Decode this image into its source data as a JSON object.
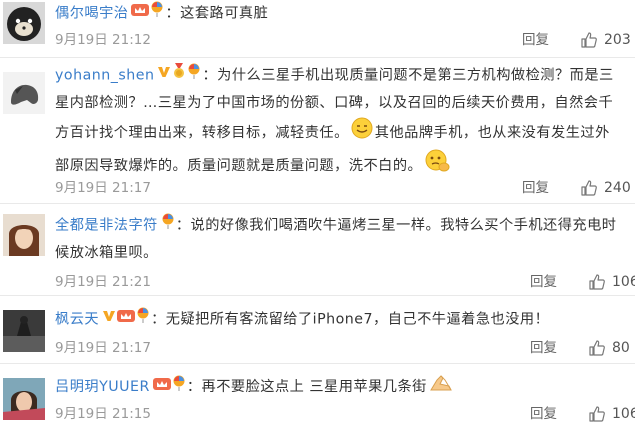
{
  "reply_label": "回复",
  "comments": [
    {
      "username": "偶尔喝宇治",
      "text": "：这套路可真脏",
      "time": "9月19日 21:12",
      "likes": "203"
    },
    {
      "username": "yohann_shen",
      "text_parts": [
        "：为什么三星手机出现质量问题不是第三方机构做检测？而是三",
        "星内部检测？…三星为了中国市场的份额、口碑，以及召回的后续天价费用，自然会千",
        "方百计找个理由出来，转移目标，减轻责任。",
        "其他品牌手机，也从来没有发生过外",
        "部原因导致爆炸的。质量问题就是质量问题，洗不白的。"
      ],
      "time": "9月19日 21:17",
      "likes": "240"
    },
    {
      "username": "全都是非法字符",
      "text_parts": [
        "：说的好像我们喝酒吹牛逼烤三星一样。我特么买个手机还得充电时",
        "候放冰箱里呗。"
      ],
      "time": "9月19日 21:21",
      "likes": "106"
    },
    {
      "username": "枫云天",
      "text": "：无疑把所有客流留给了iPhone7，自己不牛逼着急也没用！",
      "time": "9月19日 21:17",
      "likes": "80"
    },
    {
      "username": "吕明玥YUUER",
      "text": "：再不要脸这点上 三星用苹果几条街",
      "time": "9月19日 21:15",
      "likes": "106"
    }
  ],
  "colors": {
    "username": "#3a7dc9",
    "text": "#333333",
    "meta": "#9a9a9a",
    "divider": "#e9e9e9"
  }
}
